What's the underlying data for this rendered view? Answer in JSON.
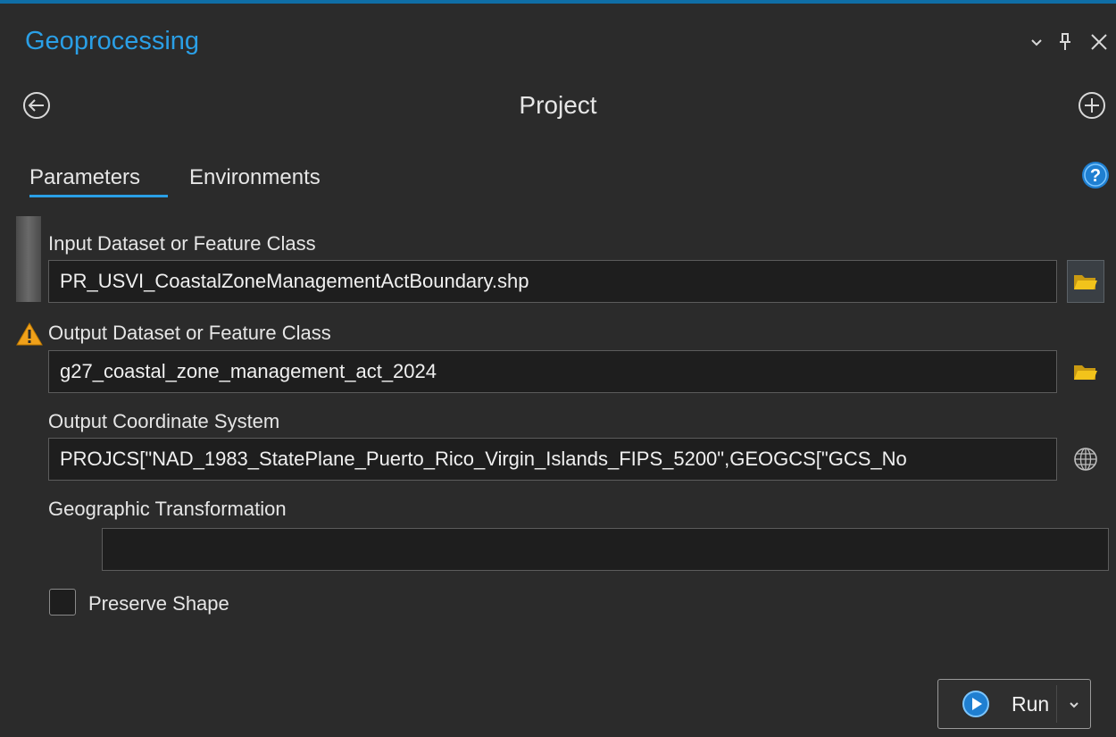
{
  "pane": {
    "title": "Geoprocessing"
  },
  "window_controls": {
    "dropdown_icon": "chevron-down-icon",
    "pin_icon": "pin-icon",
    "close_icon": "close-icon"
  },
  "header": {
    "tool_name": "Project",
    "back_icon": "back-arrow-icon",
    "add_icon": "add-icon"
  },
  "tabs": {
    "parameters": "Parameters",
    "environments": "Environments",
    "active": "Parameters",
    "help_icon": "help-icon"
  },
  "parameters": {
    "input_dataset": {
      "label": "Input Dataset or Feature Class",
      "value": "PR_USVI_CoastalZoneManagementActBoundary.shp"
    },
    "output_dataset": {
      "label": "Output Dataset or Feature Class",
      "value": "g27_coastal_zone_management_act_2024",
      "warning_icon": "warning-icon"
    },
    "output_coordinate_system": {
      "label": "Output Coordinate System",
      "value": "PROJCS[\"NAD_1983_StatePlane_Puerto_Rico_Virgin_Islands_FIPS_5200\",GEOGCS[\"GCS_No"
    },
    "geographic_transformation": {
      "label": "Geographic Transformation",
      "value": ""
    },
    "preserve_shape": {
      "label": "Preserve Shape",
      "checked": false
    }
  },
  "run": {
    "label": "Run"
  },
  "colors": {
    "accent": "#2a9fe6",
    "background": "#2b2b2b",
    "field_background": "#1e1e1e",
    "folder": "#f2c31b",
    "warning": "#f0a11a"
  }
}
